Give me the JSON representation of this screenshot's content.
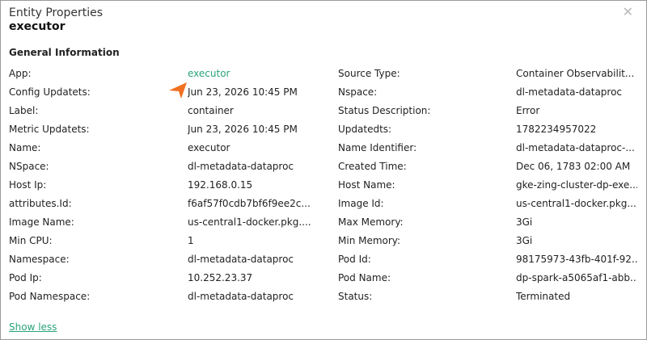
{
  "dialog": {
    "title": "Entity Properties",
    "subtitle": "executor",
    "close_icon": "close-icon",
    "section_title": "General Information",
    "show_less_label": "Show less",
    "link_color": "#2aa37a",
    "cursor_color": "#f07020"
  },
  "rows": [
    {
      "k1": "App:",
      "v1": "executor",
      "k2": "Source Type:",
      "v2": "Container Observabilit..."
    },
    {
      "k1": "Config Updatets:",
      "v1": "Jun 23, 2026 10:45 PM",
      "k2": "Nspace:",
      "v2": "dl-metadata-dataproc"
    },
    {
      "k1": "Label:",
      "v1": "container",
      "k2": "Status Description:",
      "v2": "Error"
    },
    {
      "k1": "Metric Updatets:",
      "v1": "Jun 23, 2026 10:45 PM",
      "k2": "Updatedts:",
      "v2": "1782234957022"
    },
    {
      "k1": "Name:",
      "v1": "executor",
      "k2": "Name Identifier:",
      "v2": "dl-metadata-dataproc-..."
    },
    {
      "k1": "NSpace:",
      "v1": "dl-metadata-dataproc",
      "k2": "Created Time:",
      "v2": "Dec 06, 1783 02:00 AM"
    },
    {
      "k1": "Host Ip:",
      "v1": "192.168.0.15",
      "k2": "Host Name:",
      "v2": "gke-zing-cluster-dp-exe..."
    },
    {
      "k1": "attributes.Id:",
      "v1": "f6af57f0cdb7bf6f9ee2c...",
      "k2": "Image Id:",
      "v2": "us-central1-docker.pkg...."
    },
    {
      "k1": "Image Name:",
      "v1": "us-central1-docker.pkg....",
      "k2": "Max Memory:",
      "v2": "3Gi"
    },
    {
      "k1": "Min CPU:",
      "v1": "1",
      "k2": "Min Memory:",
      "v2": "3Gi"
    },
    {
      "k1": "Namespace:",
      "v1": "dl-metadata-dataproc",
      "k2": "Pod Id:",
      "v2": "98175973-43fb-401f-92..."
    },
    {
      "k1": "Pod Ip:",
      "v1": "10.252.23.37",
      "k2": "Pod Name:",
      "v2": "dp-spark-a5065af1-abb..."
    },
    {
      "k1": "Pod Namespace:",
      "v1": "dl-metadata-dataproc",
      "k2": "Status:",
      "v2": "Terminated"
    }
  ]
}
